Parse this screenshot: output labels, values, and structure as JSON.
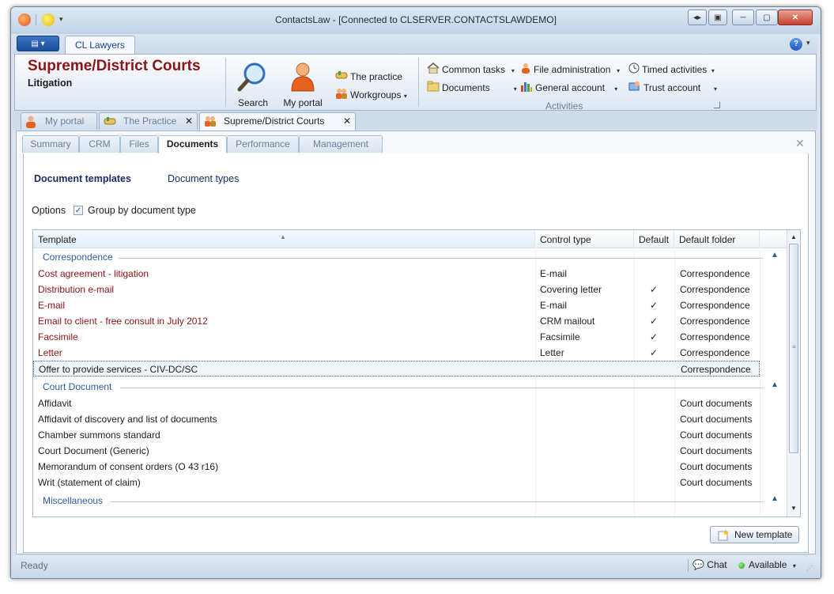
{
  "window": {
    "title": "ContactsLaw - [Connected to CLSERVER.CONTACTSLAWDEMO]",
    "app_menu_glyph": "▤ ▾",
    "help_glyph": "?"
  },
  "ribbon": {
    "tab": "CL Lawyers",
    "context_title": "Supreme/District Courts",
    "context_subtitle": "Litigation",
    "search_label": "Search",
    "my_portal_label": "My portal",
    "the_practice_label": "The practice",
    "workgroups_label": "Workgroups",
    "common_tasks_label": "Common tasks",
    "documents_label": "Documents",
    "file_administration_label": "File administration",
    "general_account_label": "General account",
    "timed_activities_label": "Timed activities",
    "trust_account_label": "Trust account",
    "group_label": "Activities"
  },
  "doc_tabs": [
    {
      "label": "My portal",
      "icon": "person-icon"
    },
    {
      "label": "The Practice",
      "icon": "handshake-icon"
    },
    {
      "label": "Supreme/District Courts",
      "icon": "group-icon"
    }
  ],
  "page_tabs": [
    "Summary",
    "CRM",
    "Files",
    "Documents",
    "Performance",
    "Management"
  ],
  "active_page_tab": "Documents",
  "subnav": {
    "active": "Document templates",
    "other": "Document types"
  },
  "options": {
    "label": "Options",
    "group_by_label": "Group by document type",
    "group_by_checked": true
  },
  "grid": {
    "columns": [
      "Template",
      "Control type",
      "Default",
      "Default folder"
    ],
    "groups": [
      {
        "name": "Correspondence",
        "rows": [
          {
            "template": "Cost agreement - litigation",
            "control": "E-mail",
            "default": "",
            "folder": "Correspondence"
          },
          {
            "template": "Distribution e-mail",
            "control": "Covering letter",
            "default": "✓",
            "folder": "Correspondence"
          },
          {
            "template": "E-mail",
            "control": "E-mail",
            "default": "✓",
            "folder": "Correspondence"
          },
          {
            "template": "Email to client - free consult in July 2012",
            "control": "CRM mailout",
            "default": "✓",
            "folder": "Correspondence"
          },
          {
            "template": "Facsimile",
            "control": "Facsimile",
            "default": "✓",
            "folder": "Correspondence"
          },
          {
            "template": "Letter",
            "control": "Letter",
            "default": "✓",
            "folder": "Correspondence"
          },
          {
            "template": "Offer to provide services - CIV-DC/SC",
            "control": "",
            "default": "",
            "folder": "Correspondence"
          }
        ]
      },
      {
        "name": "Court Document",
        "rows": [
          {
            "template": "Affidavit",
            "control": "",
            "default": "",
            "folder": "Court documents"
          },
          {
            "template": "Affidavit of discovery and list of documents",
            "control": "",
            "default": "",
            "folder": "Court documents"
          },
          {
            "template": "Chamber summons standard",
            "control": "",
            "default": "",
            "folder": "Court documents"
          },
          {
            "template": "Court Document (Generic)",
            "control": "",
            "default": "",
            "folder": "Court documents"
          },
          {
            "template": "Memorandum of consent orders (O 43 r16)",
            "control": "",
            "default": "",
            "folder": "Court documents"
          },
          {
            "template": "Writ (statement of claim)",
            "control": "",
            "default": "",
            "folder": "Court documents"
          }
        ]
      },
      {
        "name": "Miscellaneous",
        "rows": []
      }
    ]
  },
  "new_template_label": "New template",
  "status": {
    "text": "Ready",
    "chat_label": "Chat",
    "availability": "Available"
  },
  "colors": {
    "context_title": "#8c1414",
    "group_header": "#2f5b9f",
    "available_dot": "#2b9a18"
  }
}
